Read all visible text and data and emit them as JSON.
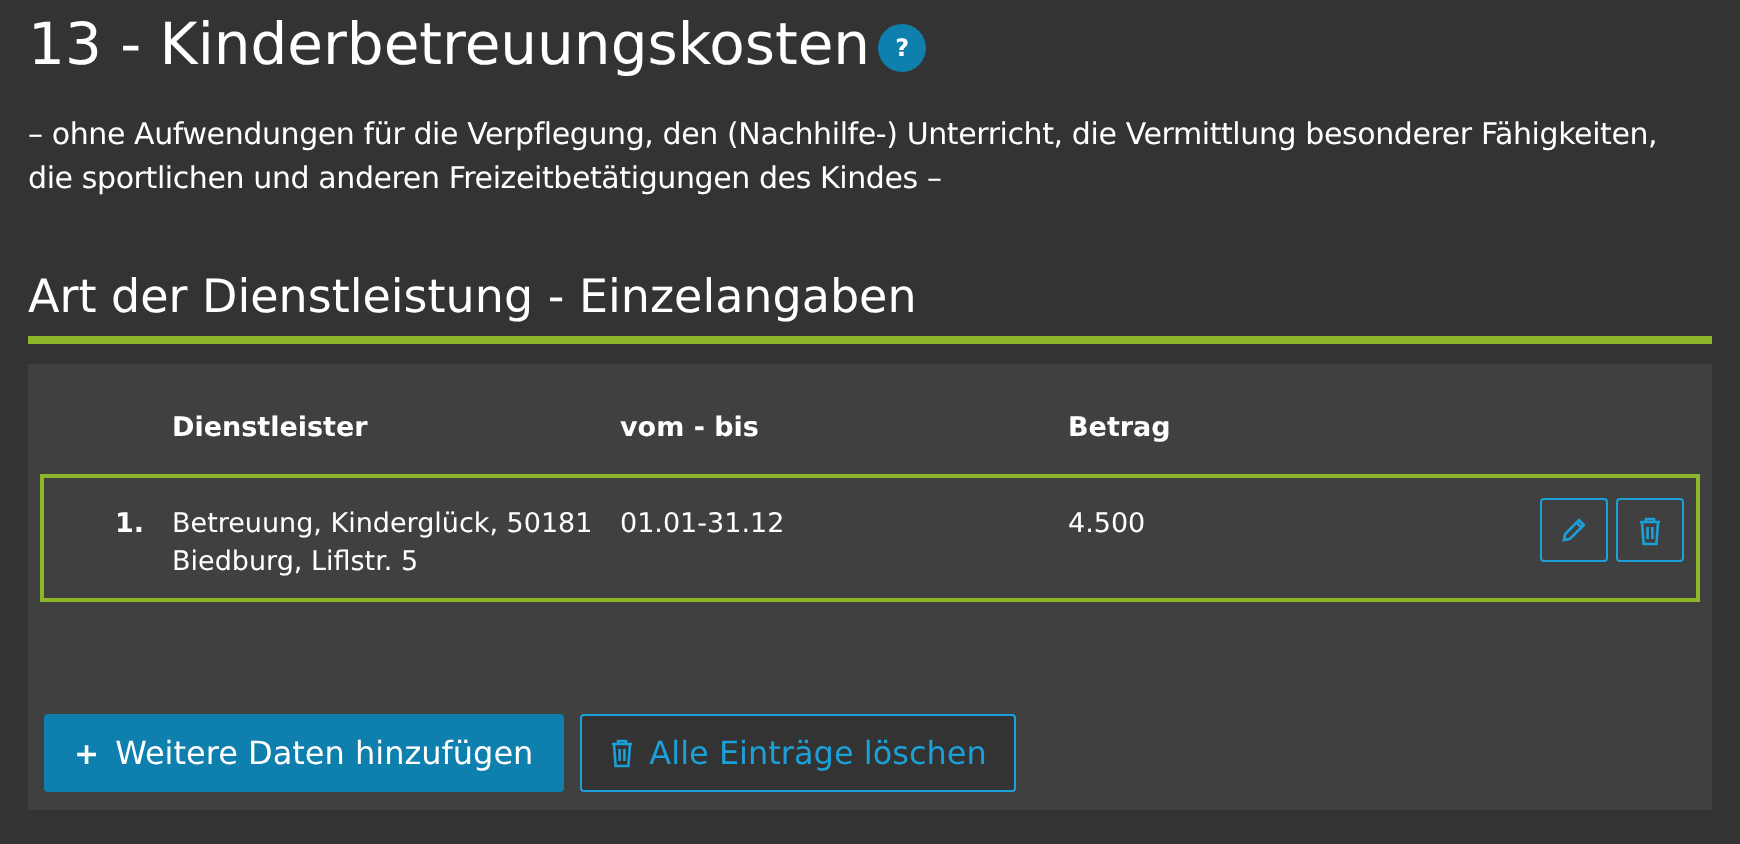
{
  "title": "13 - Kinderbetreuungskosten",
  "help": {
    "label": "?"
  },
  "description": "– ohne Aufwendungen für die Verpflegung, den (Nachhilfe-) Unterricht, die Vermittlung besonderer Fähigkeiten, die sportlichen und anderen Freizeitbetätigungen des Kindes –",
  "section_title": "Art der Dienstleistung - Einzelangaben",
  "table": {
    "columns": [
      "Dienstleister",
      "vom - bis",
      "Betrag"
    ],
    "rows": [
      {
        "number": "1.",
        "cells": [
          "Betreuung, Kinderglück, 50181 Biedburg, Liflstr. 5",
          "01.01-31.12",
          "4.500"
        ],
        "selected": true
      }
    ]
  },
  "buttons": [
    {
      "kind": "primary",
      "icon": "+",
      "label": "Weitere Daten hinzufügen"
    },
    {
      "kind": "outline",
      "label": "Alle Einträge löschen"
    }
  ]
}
